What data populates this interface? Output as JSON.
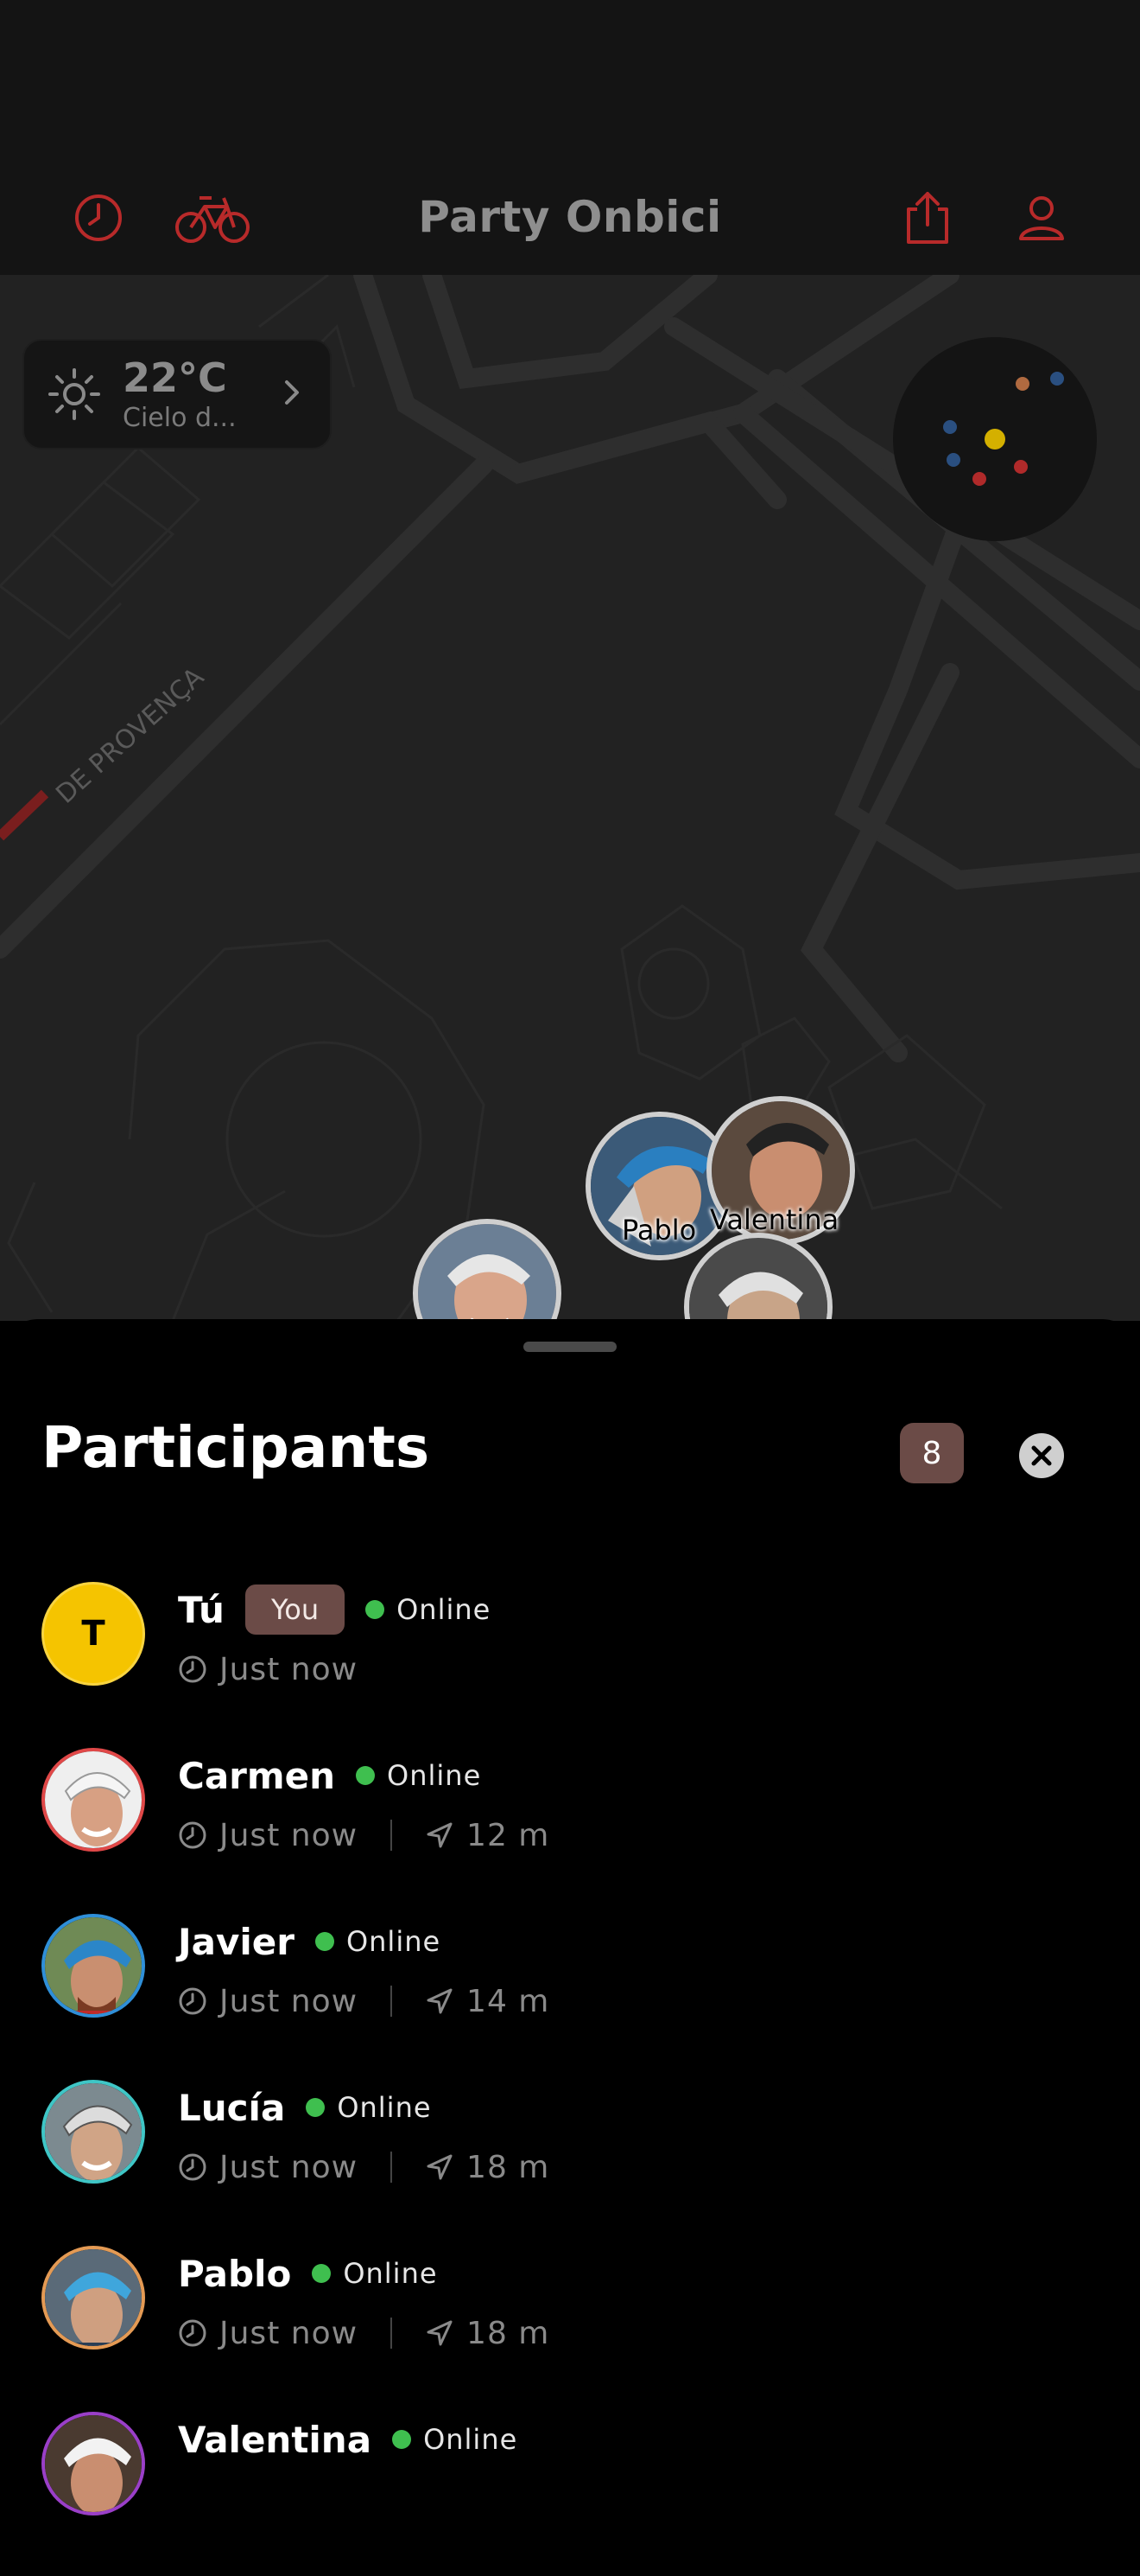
{
  "header": {
    "title": "Party Onbici",
    "icons": [
      "history-icon",
      "bike-icon",
      "share-icon",
      "profile-icon"
    ],
    "accent": "#c02a2a"
  },
  "map": {
    "street_label": "DE PROVENÇA",
    "weather": {
      "temperature": "22°C",
      "description": "Cielo d..."
    },
    "markers": [
      {
        "name": "Pablo"
      },
      {
        "name": "Valentina"
      }
    ]
  },
  "participants": {
    "title": "Participants",
    "count": "8",
    "list": [
      {
        "name": "Tú",
        "initial": "T",
        "is_you": true,
        "you_label": "You",
        "status": "Online",
        "time": "Just now",
        "distance": "",
        "ring": "#f5c400"
      },
      {
        "name": "Carmen",
        "status": "Online",
        "time": "Just now",
        "distance": "12 m",
        "ring": "#e04848"
      },
      {
        "name": "Javier",
        "status": "Online",
        "time": "Just now",
        "distance": "14 m",
        "ring": "#2f8fd8"
      },
      {
        "name": "Lucía",
        "status": "Online",
        "time": "Just now",
        "distance": "18 m",
        "ring": "#3fc6c6"
      },
      {
        "name": "Pablo",
        "status": "Online",
        "time": "Just now",
        "distance": "18 m",
        "ring": "#e49a54"
      },
      {
        "name": "Valentina",
        "status": "Online",
        "time": "",
        "distance": "",
        "ring": "#9a3fc8"
      }
    ]
  }
}
